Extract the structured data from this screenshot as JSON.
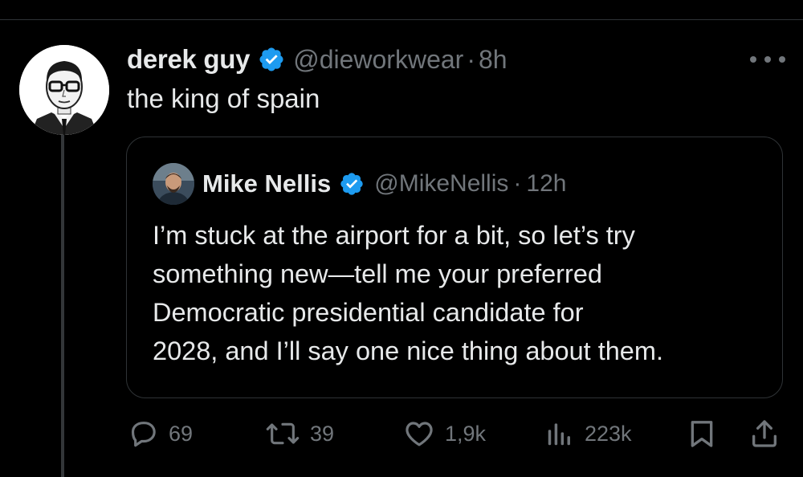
{
  "post": {
    "author_name": "derek guy",
    "handle": "@dieworkwear",
    "separator": "·",
    "time": "8h",
    "text": "the king of spain"
  },
  "quoted_post": {
    "author_name": "Mike Nellis",
    "handle": "@MikeNellis",
    "separator": "·",
    "time": "12h",
    "text_lines": [
      "I’m stuck at the airport for a bit, so let’s try",
      "something new—tell me your preferred",
      "Democratic presidential candidate for",
      "2028, and I’ll say one nice thing about them."
    ]
  },
  "actions": {
    "replies": "69",
    "reposts": "39",
    "likes": "1,9k",
    "views": "223k"
  },
  "icons": {
    "verified": "verified-badge-icon",
    "more": "more-options-icon",
    "reply": "reply-icon",
    "repost": "repost-icon",
    "like": "heart-icon",
    "views": "views-chart-icon",
    "bookmark": "bookmark-icon",
    "share": "share-icon"
  },
  "colors": {
    "background": "#000000",
    "primary_text": "#e7e9ea",
    "secondary_text": "#71767b",
    "verified_blue": "#1d9bf0",
    "border": "#2f3336"
  }
}
